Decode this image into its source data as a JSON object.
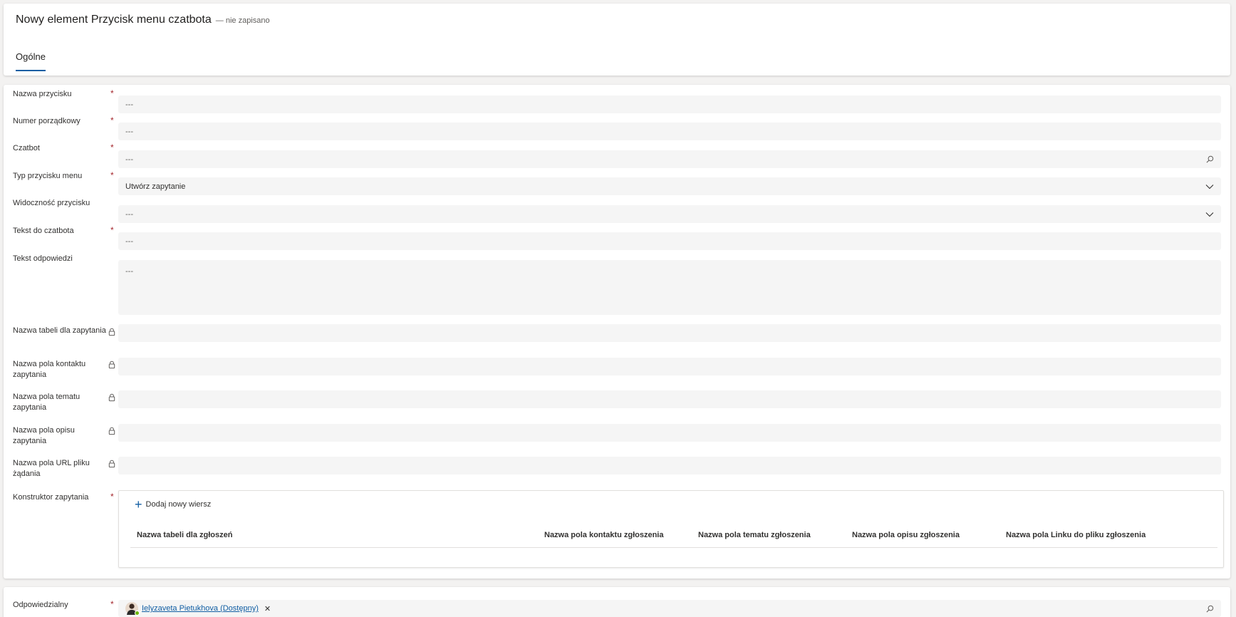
{
  "header": {
    "title": "Nowy element Przycisk menu czatbota",
    "status": "— nie zapisano",
    "tabs": [
      {
        "label": "Ogólne"
      }
    ]
  },
  "placeholder": "---",
  "fields": {
    "nazwa_przycisku": {
      "label": "Nazwa przycisku",
      "value": "---"
    },
    "numer_porzadkowy": {
      "label": "Numer porządkowy",
      "value": "---"
    },
    "czatbot": {
      "label": "Czatbot",
      "value": "---"
    },
    "typ_przycisku": {
      "label": "Typ przycisku menu",
      "value": "Utwórz zapytanie"
    },
    "widocznosc": {
      "label": "Widoczność przycisku",
      "value": "---"
    },
    "tekst_czatbot": {
      "label": "Tekst do czatbota",
      "value": "---"
    },
    "tekst_odpowiedzi": {
      "label": "Tekst odpowiedzi",
      "value": "---"
    },
    "nazwa_tabeli": {
      "label": "Nazwa tabeli dla zapytania"
    },
    "pole_kontaktu": {
      "label": "Nazwa pola kontaktu zapytania"
    },
    "pole_tematu": {
      "label": "Nazwa pola tematu zapytania"
    },
    "pole_opisu": {
      "label": "Nazwa pola opisu zapytania"
    },
    "pole_url": {
      "label": "Nazwa pola URL pliku żądania"
    },
    "konstruktor": {
      "label": "Konstruktor zapytania"
    }
  },
  "subgrid": {
    "add_label": "Dodaj nowy wiersz",
    "columns": [
      "Nazwa tabeli dla zgłoszeń",
      "Nazwa pola kontaktu zgłoszenia",
      "Nazwa pola tematu zgłoszenia",
      "Nazwa pola opisu zgłoszenia",
      "Nazwa pola Linku do pliku zgłoszenia"
    ]
  },
  "owner": {
    "label": "Odpowiedzialny",
    "name": "Ielyzaveta Pietukhova (Dostępny)"
  },
  "colors": {
    "accent": "#115ea3",
    "required": "#a4262c",
    "presence": "#6bb700"
  }
}
